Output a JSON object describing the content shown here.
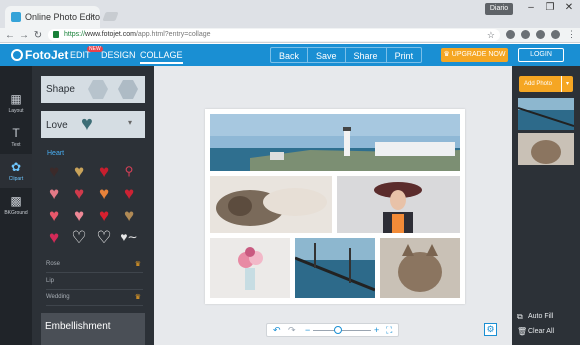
{
  "browser": {
    "tab_title": "Online Photo Editor - Tu",
    "tab_close": "×",
    "profile_name": "Diario",
    "window_buttons": [
      "–",
      "❐",
      "✕"
    ],
    "nav": {
      "back": "←",
      "forward": "→",
      "reload": "↻"
    },
    "url_secure": "https://",
    "url_host": "www.fotojet.com",
    "url_path": "/app.html?entry=collage",
    "star": "☆",
    "menu": "⋮"
  },
  "app": {
    "logo": "FotoJet",
    "nav": {
      "edit": "EDIT",
      "design": "DESIGN",
      "collage": "COLLAGE",
      "new_badge": "NEW"
    },
    "actions": [
      "Back",
      "Save",
      "Share",
      "Print"
    ],
    "upgrade": "♛ UPGRADE NOW",
    "login": "LOGIN"
  },
  "rail": [
    {
      "label": "Layout",
      "icon": "grid-icon",
      "glyph": "▦"
    },
    {
      "label": "Text",
      "icon": "text-icon",
      "glyph": "T"
    },
    {
      "label": "Clipart",
      "icon": "clipart-icon",
      "glyph": "✿"
    },
    {
      "label": "BKGround",
      "icon": "background-icon",
      "glyph": "▩"
    }
  ],
  "clipart": {
    "shape": "Shape",
    "love": "Love",
    "heart_title": "Heart",
    "categories": [
      {
        "name": "Rose",
        "premium": true
      },
      {
        "name": "Lip",
        "premium": false
      },
      {
        "name": "Wedding",
        "premium": true
      }
    ],
    "embellishment": "Embellishment",
    "crown": "♛"
  },
  "zoom": {
    "undo": "↶",
    "redo": "↷",
    "minus": "−",
    "plus": "+",
    "fit": "⛶",
    "level": 0.5
  },
  "right": {
    "add_photo": "Add Photo",
    "chev": "▾",
    "auto_fill": "Auto Fill",
    "clear_all": "Clear All"
  },
  "colors": {
    "brand": "#1a8fd3",
    "accent": "#f5a623",
    "panel": "#2c3137",
    "rail": "#202429"
  }
}
